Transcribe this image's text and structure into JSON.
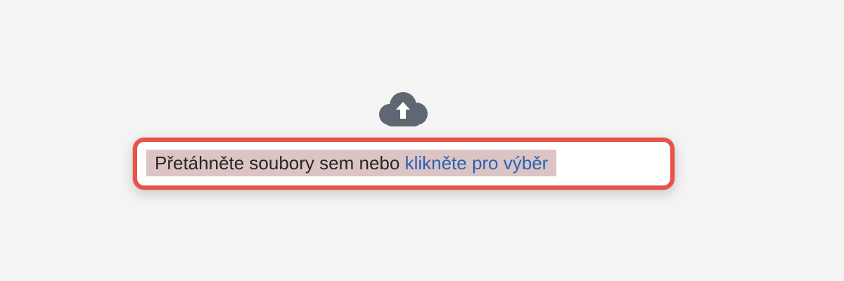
{
  "dropzone": {
    "icon": "cloud-upload-icon",
    "prompt_text": "Přetáhněte soubory sem nebo ",
    "link_text": "klikněte pro výběr"
  },
  "colors": {
    "background": "#f4f4f4",
    "icon": "#5f6872",
    "highlight_border": "#e8524a",
    "text_highlight": "#dbc4c3",
    "link": "#2a62b5",
    "text": "#2a2526"
  }
}
